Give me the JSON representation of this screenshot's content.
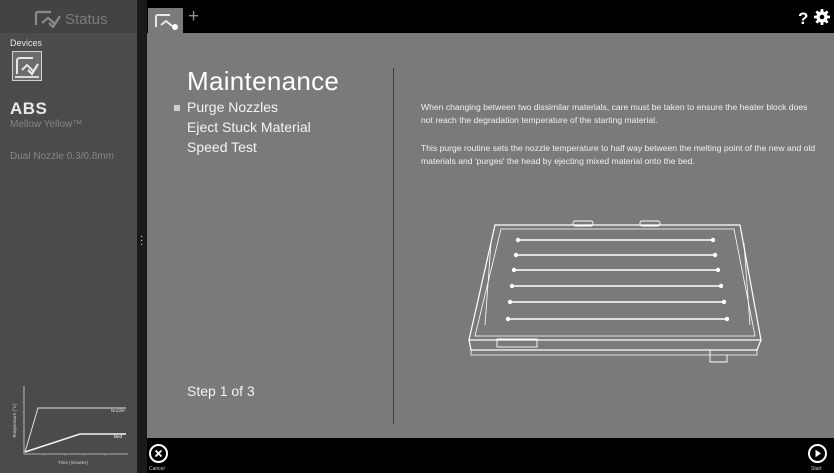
{
  "sidebar": {
    "title": "Status",
    "devices_label": "Devices",
    "material": "ABS",
    "color_name": "Mellow Yellow™",
    "nozzle": "Dual Nozzle 0.3/0.8mm",
    "chart": {
      "ylabel": "Temperature (°C)",
      "xlabel": "Time (minutes)",
      "series_nozzle": "Nozzle",
      "series_bed": "Bed"
    }
  },
  "tabs": {
    "add_label": "+"
  },
  "toolbar": {
    "help_label": "?"
  },
  "main": {
    "title": "Maintenance",
    "menu": [
      "Purge Nozzles",
      "Eject Stuck Material",
      "Speed Test"
    ],
    "selected_index": 0,
    "step": "Step 1 of 3",
    "paragraph1": "When changing between two dissimilar materials, care must be taken to ensure the heater block does not reach the degradation temperature of the starting material.",
    "paragraph2": "This purge routine sets the nozzle temperature to half way between the melting point of the new and old materials and 'purges' the head by ejecting mixed material onto the bed."
  },
  "bottom": {
    "cancel_label": "Cancel",
    "start_label": "Start"
  },
  "icons": {
    "logo": "printer-logo-icon",
    "gear": "gear-icon",
    "cancel": "close-circle-icon",
    "start": "play-circle-icon"
  }
}
